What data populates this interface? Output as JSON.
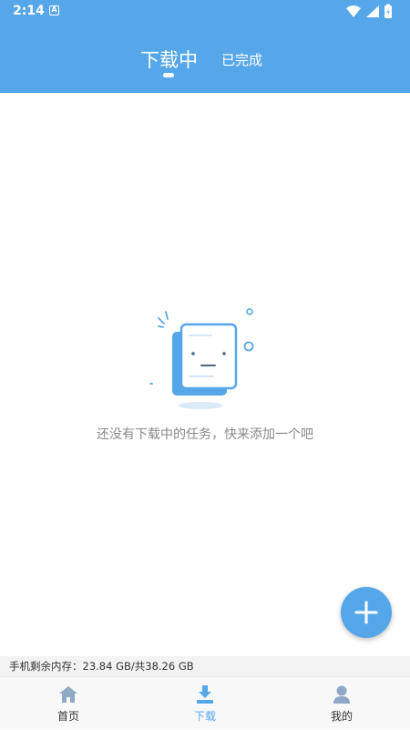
{
  "status_bar": {
    "time": "2:14",
    "notification_icon": "A"
  },
  "header": {
    "tabs": [
      {
        "label": "下载中",
        "active": true
      },
      {
        "label": "已完成",
        "active": false
      }
    ]
  },
  "empty_state": {
    "message": "还没有下载中的任务，快来添加一个吧",
    "icon": "empty-document-face-icon"
  },
  "fab": {
    "icon": "plus-icon"
  },
  "storage": {
    "text": "手机剩余内存：23.84 GB/共38.26 GB"
  },
  "bottom_nav": {
    "items": [
      {
        "label": "首页",
        "icon": "home-icon",
        "active": false
      },
      {
        "label": "下载",
        "icon": "download-icon",
        "active": true
      },
      {
        "label": "我的",
        "icon": "person-icon",
        "active": false
      }
    ]
  },
  "colors": {
    "primary": "#56a7e9",
    "text_muted": "#888888",
    "icon_gray": "#8fa8c6"
  }
}
